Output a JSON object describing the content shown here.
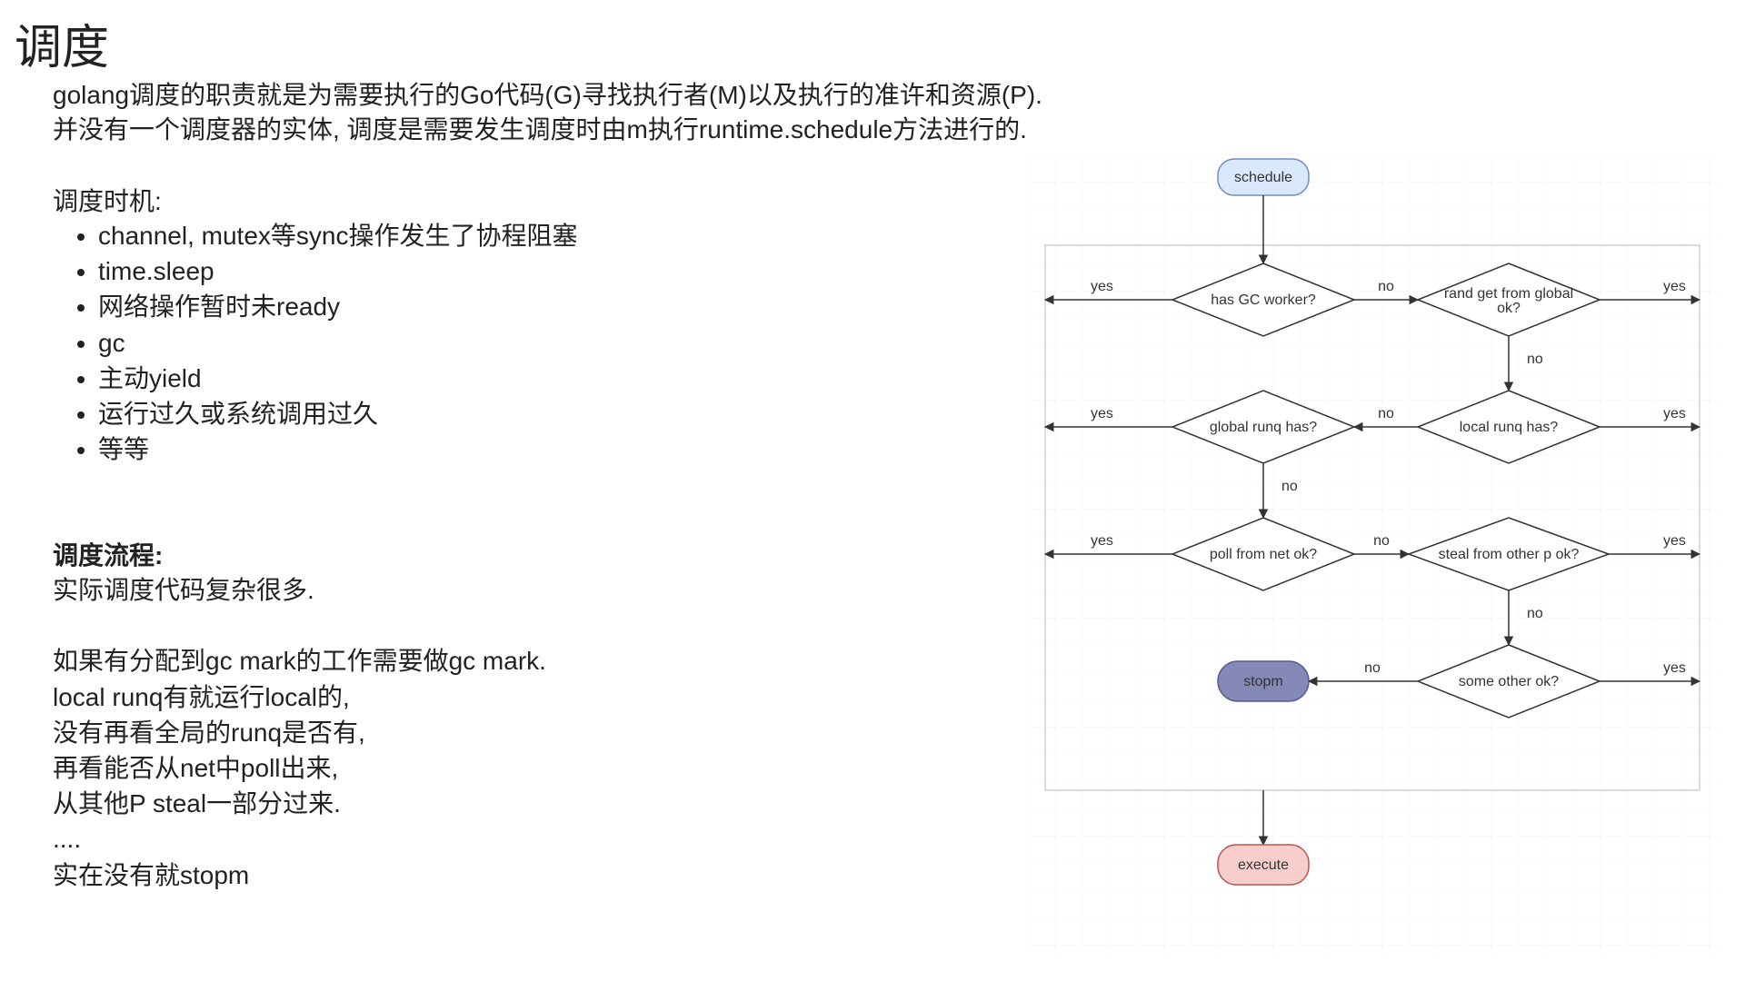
{
  "title": "调度",
  "intro_line1": "golang调度的职责就是为需要执行的Go代码(G)寻找执行者(M)以及执行的准许和资源(P).",
  "intro_line2": "并没有一个调度器的实体, 调度是需要发生调度时由m执行runtime.schedule方法进行的.",
  "timing_title": "调度时机:",
  "bullets": [
    "channel, mutex等sync操作发生了协程阻塞",
    "time.sleep",
    "网络操作暂时未ready",
    "gc",
    "主动yield",
    "运行过久或系统调用过久",
    "等等"
  ],
  "flow_title": "调度流程:",
  "flow_body": "实际调度代码复杂很多.\n\n如果有分配到gc mark的工作需要做gc mark.\nlocal runq有就运行local的,\n没有再看全局的runq是否有,\n再看能否从net中poll出来,\n从其他P steal一部分过来.\n....\n实在没有就stopm",
  "diagram": {
    "nodes": {
      "schedule": "schedule",
      "gc_worker": "has GC worker?",
      "rand_global": "rand get from global ok?",
      "global_runq": "global runq has?",
      "local_runq": "local runq has?",
      "poll_net": "poll from net ok?",
      "steal": "steal from other p ok?",
      "stopm": "stopm",
      "some_other": "some other ok?",
      "execute": "execute"
    },
    "labels": {
      "yes": "yes",
      "no": "no"
    },
    "colors": {
      "schedule_fill": "#dae8fc",
      "schedule_stroke": "#6c8ebf",
      "stopm_fill": "#8489b8",
      "stopm_stroke": "#565c8f",
      "execute_fill": "#f8cecc",
      "execute_stroke": "#b85450",
      "diamond_fill": "#ffffff",
      "diamond_stroke": "#333333",
      "line": "#333333",
      "frame": "#cfcfcf"
    }
  }
}
